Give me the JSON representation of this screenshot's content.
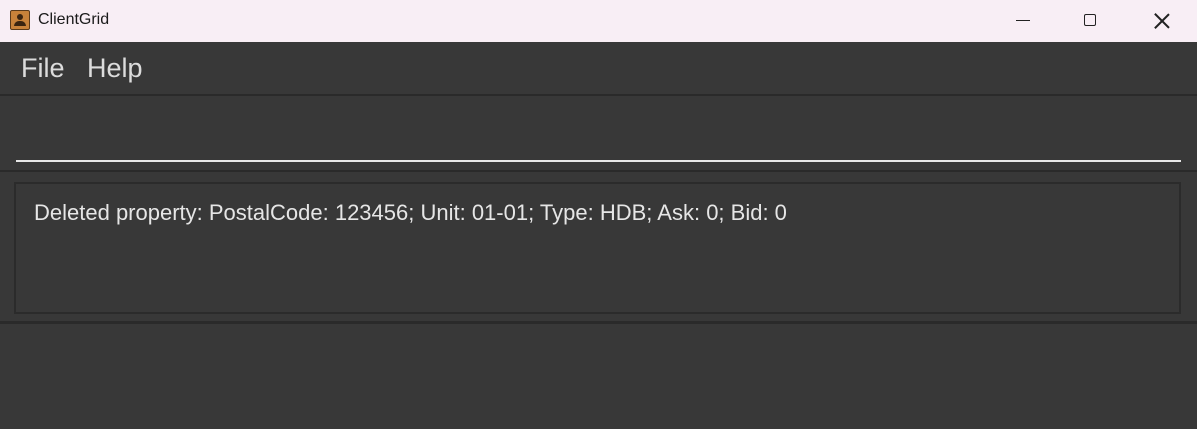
{
  "window": {
    "title": "ClientGrid",
    "app_icon": "contact-book-icon"
  },
  "controls": {
    "minimize_icon": "minimize-icon",
    "maximize_icon": "maximize-icon",
    "close_icon": "close-icon"
  },
  "menu": {
    "items": [
      {
        "label": "File"
      },
      {
        "label": "Help"
      }
    ]
  },
  "command": {
    "value": "",
    "placeholder": ""
  },
  "result": {
    "message": "Deleted property: PostalCode: 123456; Unit: 01-01; Type: HDB; Ask: 0; Bid: 0"
  },
  "colors": {
    "titlebar_bg": "#f8eef5",
    "app_bg": "#383838",
    "text": "#e6e6e6"
  }
}
